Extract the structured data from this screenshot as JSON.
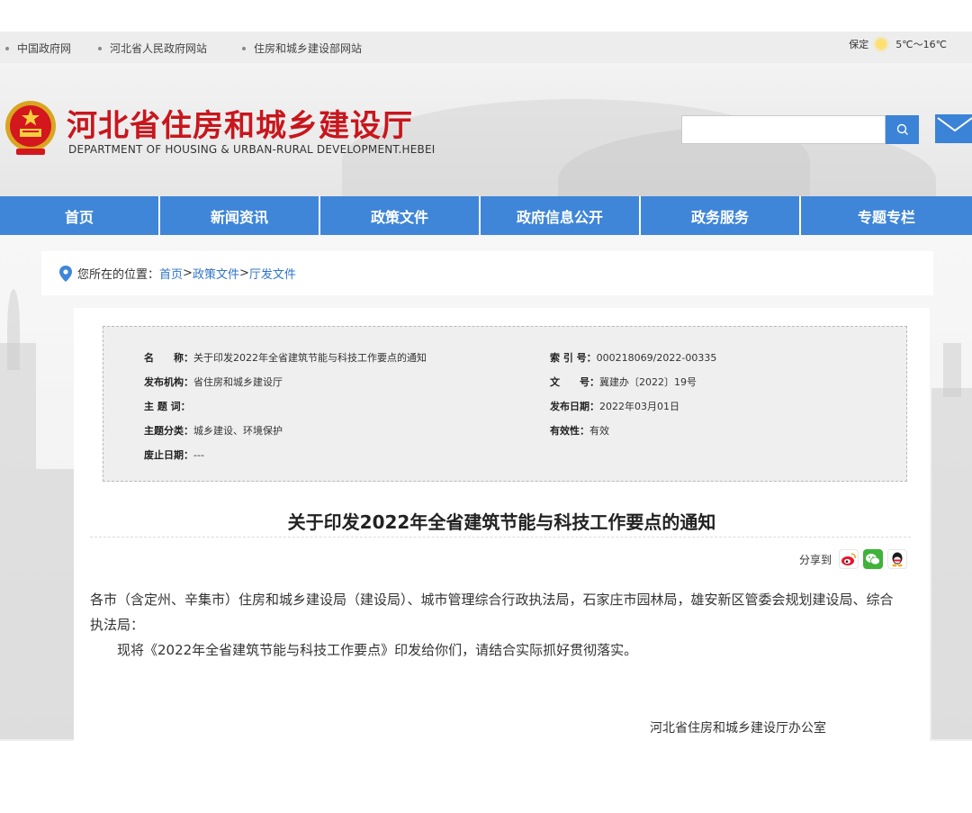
{
  "topbar": {
    "links": [
      "中国政府网",
      "河北省人民政府网站",
      "住房和城乡建设部网站"
    ],
    "weather": {
      "city": "保定",
      "temp": "5℃～16℃"
    }
  },
  "header": {
    "title_cn": "河北省住房和城乡建设厅",
    "title_en": "DEPARTMENT OF HOUSING & URBAN-RURAL DEVELOPMENT.HEBEI",
    "search_placeholder": ""
  },
  "nav": {
    "items": [
      "首页",
      "新闻资讯",
      "政策文件",
      "政府信息公开",
      "政务服务",
      "专题专栏"
    ]
  },
  "breadcrumb": {
    "prefix": "您所在的位置：",
    "items": [
      "首页",
      "政策文件",
      "厅发文件"
    ],
    "separator": ">"
  },
  "meta": {
    "name_label": "名　　称：",
    "name_value": "关于印发2022年全省建筑节能与科技工作要点的通知",
    "index_label": "索 引 号：",
    "index_value": "000218069/2022-00335",
    "issuer_label": "发布机构：",
    "issuer_value": "省住房和城乡建设厅",
    "docno_label": "文　　号：",
    "docno_value": "冀建办〔2022〕19号",
    "subject_label": "主 题 词：",
    "subject_value": "",
    "date_label": "发布日期：",
    "date_value": "2022年03月01日",
    "category_label": "主题分类：",
    "category_value": "城乡建设、环境保护",
    "validity_label": "有效性：",
    "validity_value": "有效",
    "expiry_label": "废止日期：",
    "expiry_value": "---"
  },
  "article": {
    "title": "关于印发2022年全省建筑节能与科技工作要点的通知",
    "share_label": "分享到",
    "paragraph1": "各市（含定州、辛集市）住房和城乡建设局（建设局）、城市管理综合行政执法局，石家庄市园林局，雄安新区管委会规划建设局、综合执法局：",
    "paragraph2": "现将《2022年全省建筑节能与科技工作要点》印发给你们，请结合实际抓好贯彻落实。",
    "signature": "河北省住房和城乡建设厅办公室"
  },
  "colors": {
    "brand_red": "#c8161d",
    "nav_blue": "#3f86d8",
    "link_blue": "#2f74c8"
  },
  "icons": [
    "sun-icon",
    "search-icon",
    "mail-icon",
    "location-pin-icon",
    "weibo-icon",
    "wechat-icon",
    "qq-icon"
  ]
}
